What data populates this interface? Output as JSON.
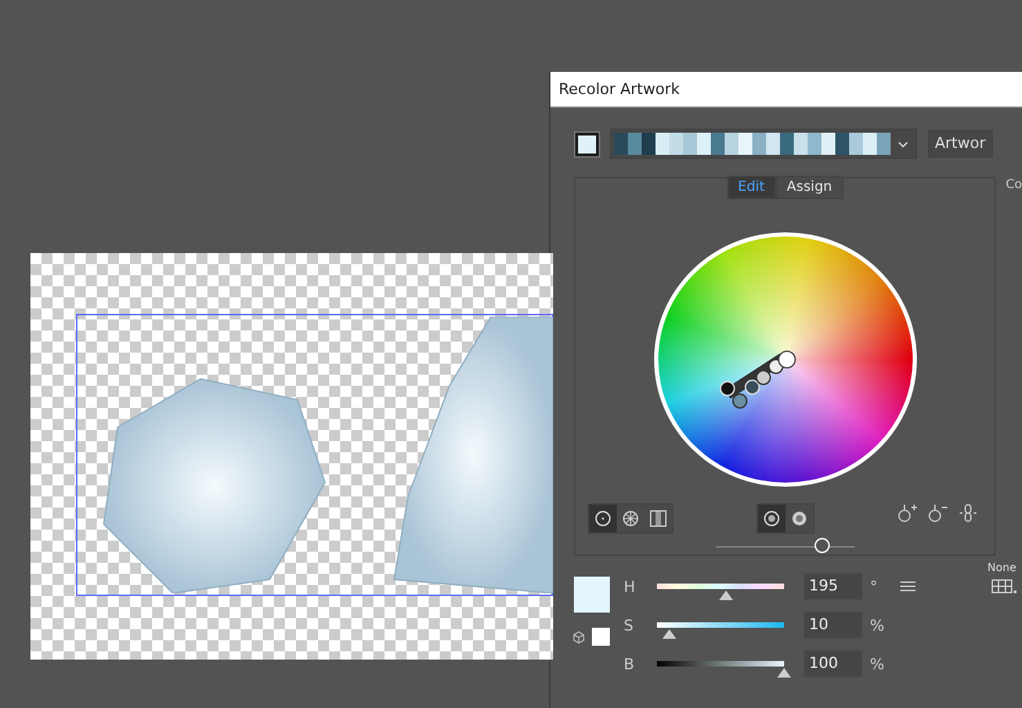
{
  "dialog": {
    "title": "Recolor Artwork",
    "artwork_field": {
      "value": "Artwor"
    },
    "tabs": [
      {
        "label": "Edit",
        "selected": true
      },
      {
        "label": "Assign",
        "selected": false
      }
    ],
    "side_header": "Co",
    "wheel_modes": [
      {
        "kind": "smooth",
        "selected": true
      },
      {
        "kind": "segmented",
        "selected": false
      },
      {
        "kind": "bars",
        "selected": false
      }
    ],
    "display_toggles": [
      {
        "kind": "saturation",
        "selected": true
      },
      {
        "kind": "brightness",
        "selected": false
      }
    ],
    "wheel_slider": {
      "level": 0.77
    },
    "channels": [
      {
        "label": "H",
        "value": "195",
        "unit": "°",
        "kind": "hue",
        "level": 0.54
      },
      {
        "label": "S",
        "value": "10",
        "unit": "%",
        "kind": "saturation",
        "level": 0.1
      },
      {
        "label": "B",
        "value": "100",
        "unit": "%",
        "kind": "brightness",
        "level": 1.0
      }
    ],
    "none_label": "None"
  }
}
